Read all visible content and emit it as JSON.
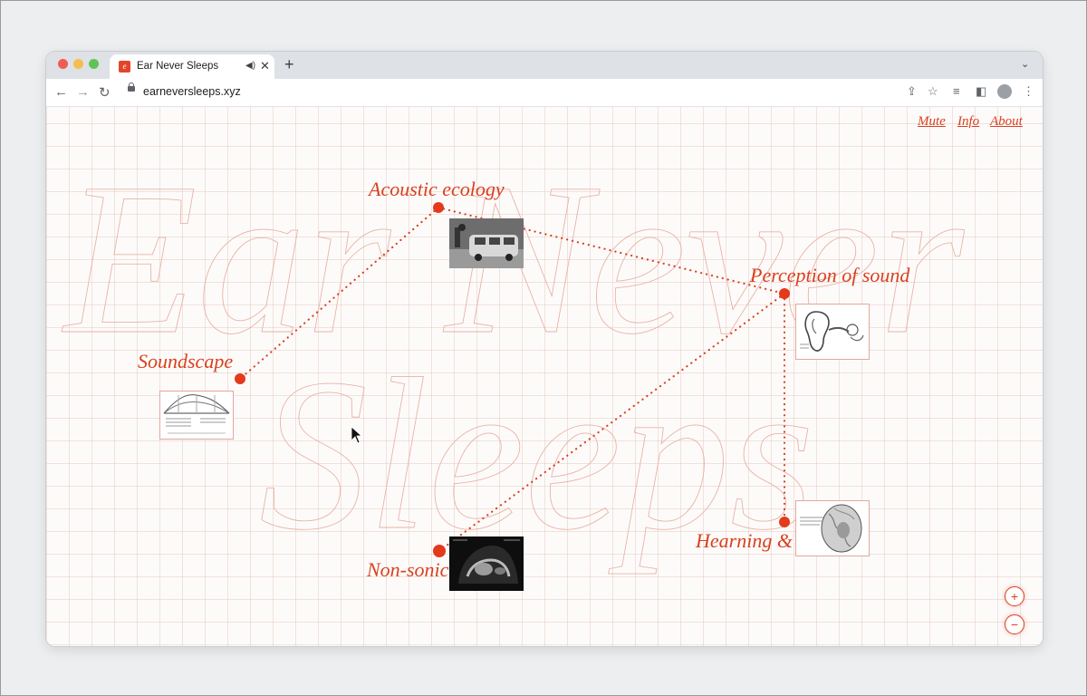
{
  "browser": {
    "tab_title": "Ear Never Sleeps",
    "url": "earneversleeps.xyz",
    "new_tab": "+",
    "tab_close": "✕",
    "audio_icon": "speaker-icon",
    "tab_list": "⌄"
  },
  "site": {
    "big_title_line1": "Ear Never",
    "big_title_line2": "Sleeps",
    "accent": "#d9401f",
    "nav": {
      "mute": "Mute",
      "info": "Info",
      "about": "About"
    },
    "nodes": {
      "acoustic": "Acoustic ecology",
      "perception": "Perception of sound",
      "soundscape": "Soundscape",
      "nonsonic": "Non-sonic sound",
      "memory": "Hearning & memory"
    },
    "zoom_in": "+",
    "zoom_out": "−"
  }
}
